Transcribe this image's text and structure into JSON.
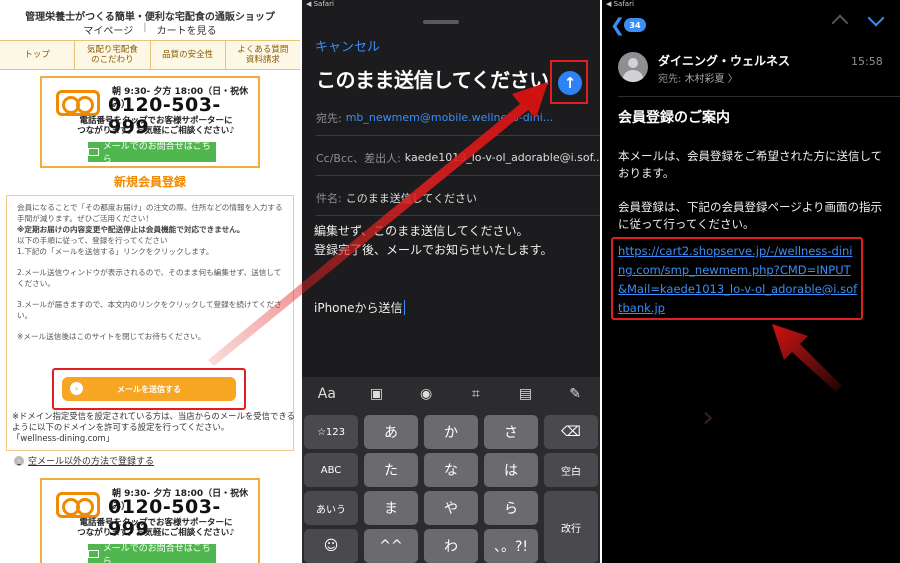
{
  "site": {
    "header": "管理栄養士がつくる簡単・便利な宅配食の通販ショップ",
    "mypage": "マイページ",
    "sep": "|",
    "cart": "カートを見る",
    "nav": [
      "トップ",
      "気配り宅配食\nのこだわり",
      "品質の安全性",
      "よくある質問\n資料請求"
    ],
    "contact": {
      "hours": "朝 9:30- 夕方 18:00（日・祝休み）",
      "phone": "0120-503-999",
      "note": "電話番号をタップでお客様サポーターに\nつながります。お気軽にご相談ください♪",
      "mail_button": "メールでのお問合せはこちら"
    },
    "title": "新規会員登録",
    "body": [
      "会員になることで「その都度お届け」の注文の際、住所などの情報を入力する手間が減ります。ぜひご活用ください！",
      "※定期お届けの内容変更や配送停止は会員機能で対応できません。",
      "以下の手順に従って、登録を行ってください",
      "1.下記の「メールを送信する」リンクをクリックします。",
      "",
      "2.メール送信ウィンドウが表示されるので、そのまま何も編集せず、送信してください。",
      "",
      "3.メールが届きますので、本文内のリンクをクリックして登録を続けてください。",
      "",
      "※メール送信後はこのサイトを閉じてお待ちください。"
    ],
    "send_button": "メールを送信する",
    "footer_note": "※ドメイン指定受信を設定されている方は、当店からのメールを受信できるように以下のドメインを許可する設定を行ってください。\n「wellness-dining.com」",
    "other_method": "空メール以外の方法で登録する"
  },
  "compose": {
    "status": "◀ Safari",
    "cancel": "キャンセル",
    "title": "このまま送信してください",
    "send_icon": "↑",
    "to_label": "宛先:",
    "to_value": "mb_newmem@mobile.wellness-dini...",
    "cc_label": "Cc/Bcc、差出人:",
    "cc_value": "kaede1013_lo-v-ol_adorable@i.sof...",
    "subject_label": "件名:",
    "subject_value": "このまま送信してください",
    "body_lines": [
      "編集せず、このまま送信してください。",
      "登録完了後、メールでお知らせいたします。"
    ],
    "signature": "iPhoneから送信",
    "toolbar": [
      "Aa",
      "photo-icon",
      "camera-icon",
      "scan-icon",
      "document-icon",
      "markup-icon"
    ],
    "keys": {
      "r1": [
        "☆123",
        "あ",
        "か",
        "さ",
        "⌫"
      ],
      "r2": [
        "ABC",
        "た",
        "な",
        "は",
        "空白"
      ],
      "r3": [
        "あいう",
        "ま",
        "や",
        "ら",
        "改行"
      ],
      "r4": [
        "☺",
        "^^",
        "わ",
        "、。?!"
      ]
    }
  },
  "inbox": {
    "status": "◀ Safari",
    "badge": "34",
    "sender": "ダイニング・ウェルネス",
    "to_label": "宛先:",
    "to_name": "木村彩夏 〉",
    "time": "15:58",
    "subject": "会員登録のご案内",
    "body": [
      "本メールは、会員登録をご希望された方に送信しております。",
      "",
      "会員登録は、下記の会員登録ページより画面の指示に従って行ってください。"
    ],
    "link": "https://cart2.shopserve.jp/-/wellness-dining.com/smp_newmem.php?CMD=INPUT&Mail=kaede1013_lo-v-ol_adorable@i.softbank.jp"
  },
  "colors": {
    "orange": "#f08a00",
    "highlight": "#e02020",
    "ios_blue": "#3a8ef6",
    "green": "#4fb74e"
  }
}
